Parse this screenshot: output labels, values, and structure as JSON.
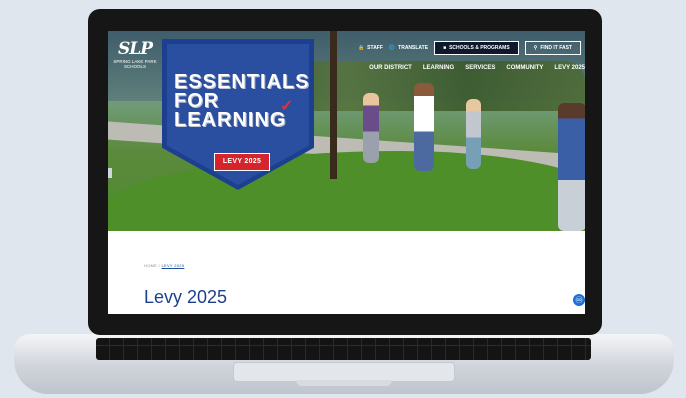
{
  "logo": {
    "mark": "SLP",
    "name": "SPRING LAKE PARK SCHOOLS"
  },
  "utility_nav": [
    {
      "label": "STAFF",
      "icon": "lock-icon"
    },
    {
      "label": "TRANSLATE",
      "icon": "globe-icon"
    },
    {
      "label": "SCHOOLS & PROGRAMS",
      "icon": "school-icon"
    },
    {
      "label": "FIND IT FAST",
      "icon": "search-icon"
    }
  ],
  "main_nav": [
    "OUR DISTRICT",
    "LEARNING",
    "SERVICES",
    "COMMUNITY",
    "LEVY 2025"
  ],
  "hero": {
    "badge_lines": [
      "ESSENTIALS",
      "FOR",
      "LEARNING"
    ],
    "badge_button": "LEVY 2025"
  },
  "breadcrumb": {
    "home": "HOME",
    "separator": "/",
    "current": "LEVY 2025"
  },
  "page_title": "Levy 2025",
  "colors": {
    "brand_blue": "#1d3f8f",
    "brand_red": "#d6242c"
  }
}
